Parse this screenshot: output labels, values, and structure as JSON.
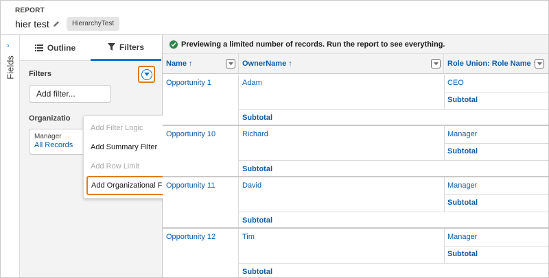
{
  "header": {
    "report_label": "REPORT",
    "title": "hier test",
    "report_type": "HierarchyTest"
  },
  "fields_rail": {
    "label": "Fields"
  },
  "panel": {
    "tabs": [
      {
        "label": "Outline",
        "active": false
      },
      {
        "label": "Filters",
        "active": true
      }
    ],
    "filters_heading": "Filters",
    "add_filter_label": "Add filter...",
    "org_heading": "Organizational Filter",
    "org_card": {
      "label": "Manager",
      "value": "All Records"
    }
  },
  "menu": {
    "items": [
      {
        "label": "Add Filter Logic",
        "disabled": true
      },
      {
        "label": "Add Summary Filter",
        "disabled": false
      },
      {
        "label": "Add Row Limit",
        "disabled": true
      },
      {
        "label": "Add Organizational Filter",
        "disabled": false,
        "highlighted": true
      }
    ]
  },
  "preview": {
    "message": "Previewing a limited number of records. Run the report to see everything."
  },
  "table": {
    "columns": [
      {
        "label": "Name ↑"
      },
      {
        "label": "OwnerName ↑"
      },
      {
        "label": "Role Union: Role Name ↑"
      }
    ],
    "groups": [
      {
        "name": "Opportunity 1",
        "owner": "Adam",
        "role": "CEO",
        "role_subtotal": "Subtotal",
        "owner_subtotal": "Subtotal"
      },
      {
        "name": "Opportunity 10",
        "owner": "Richard",
        "role": "Manager",
        "role_subtotal": "Subtotal",
        "owner_subtotal": "Subtotal"
      },
      {
        "name": "Opportunity 11",
        "owner": "David",
        "role": "Manager",
        "role_subtotal": "Subtotal",
        "owner_subtotal": "Subtotal"
      },
      {
        "name": "Opportunity 12",
        "owner": "Tim",
        "role": "Manager",
        "role_subtotal": "Subtotal",
        "owner_subtotal": "Subtotal"
      }
    ]
  },
  "colors": {
    "accent": "#0176d3",
    "link": "#0b5cab",
    "highlight": "#e07b1a",
    "success": "#2e844a"
  }
}
